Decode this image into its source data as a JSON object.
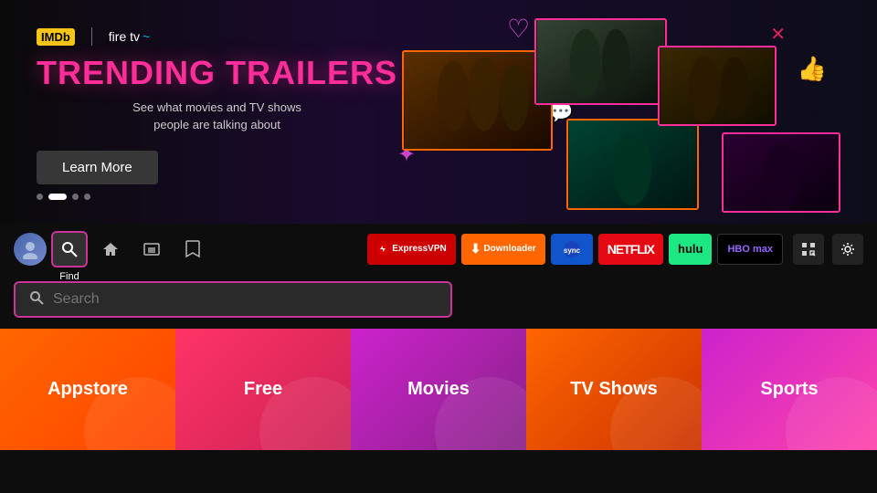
{
  "hero": {
    "logo_imdb": "IMDb",
    "logo_firetv": "fire tv",
    "title": "TRENDING TRAILERS",
    "subtitle_line1": "See what movies and TV shows",
    "subtitle_line2": "people are talking about",
    "learn_more": "Learn More",
    "dots": [
      "dot",
      "dot-active",
      "dot",
      "dot"
    ]
  },
  "navbar": {
    "find_label": "Find",
    "apps": [
      {
        "name": "ExpressVPN",
        "label": "ExpressVPN"
      },
      {
        "name": "Downloader",
        "label": "Downloader"
      },
      {
        "name": "App3",
        "label": "⬇"
      },
      {
        "name": "Netflix",
        "label": "NETFLIX"
      },
      {
        "name": "Hulu",
        "label": "hulu"
      },
      {
        "name": "HBOMax",
        "label": "HBO max"
      }
    ]
  },
  "search": {
    "placeholder": "Search"
  },
  "categories": [
    {
      "id": "appstore",
      "label": "Appstore",
      "class": "cat-appstore"
    },
    {
      "id": "free",
      "label": "Free",
      "class": "cat-free"
    },
    {
      "id": "movies",
      "label": "Movies",
      "class": "cat-movies"
    },
    {
      "id": "tvshows",
      "label": "TV Shows",
      "class": "cat-tvshows"
    },
    {
      "id": "sports",
      "label": "Sports",
      "class": "cat-sports"
    }
  ]
}
